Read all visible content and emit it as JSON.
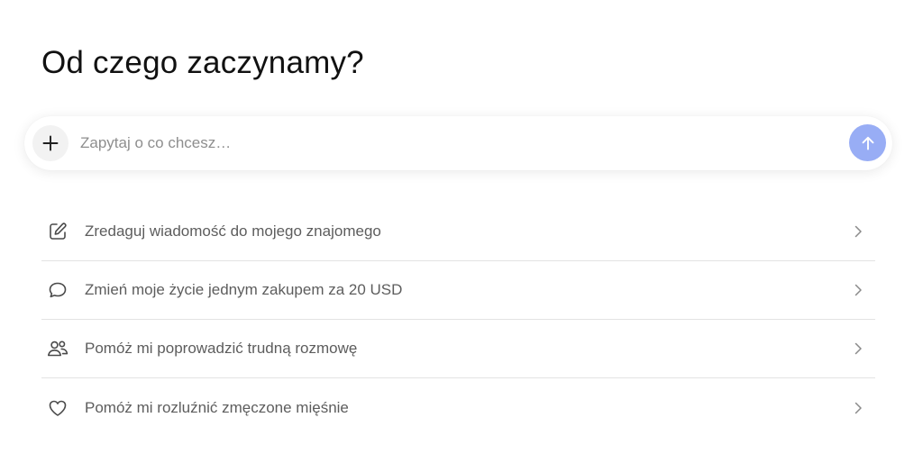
{
  "heading": "Od czego zaczynamy?",
  "composer": {
    "placeholder": "Zapytaj o co chcesz…",
    "value": "",
    "attach_icon": "plus-icon",
    "send_icon": "arrow-up-icon",
    "send_color": "#98adf5"
  },
  "suggestions": [
    {
      "icon": "pencil-square-icon",
      "label": "Zredaguj wiadomość do mojego znajomego"
    },
    {
      "icon": "speech-bubble-icon",
      "label": "Zmień moje życie jednym zakupem za 20 USD"
    },
    {
      "icon": "people-icon",
      "label": "Pomóż mi poprowadzić trudną rozmowę"
    },
    {
      "icon": "heart-icon",
      "label": "Pomóż mi rozluźnić zmęczone mięśnie"
    }
  ]
}
